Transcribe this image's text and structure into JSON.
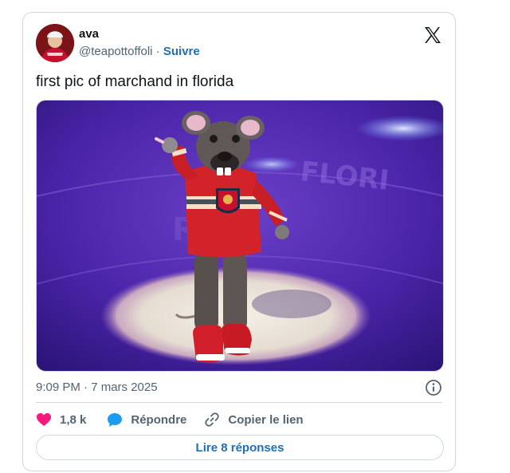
{
  "author": {
    "name": "ava",
    "handle": "@teapottoffoli",
    "separator": " · ",
    "follow_label": "Suivre"
  },
  "tweet": {
    "text": "first pic of marchand in florida",
    "timestamp": "9:09 PM · 7 mars 2025",
    "media_icon": "panthers-mascot-photo"
  },
  "actions": {
    "like_count": "1,8 k",
    "reply_label": "Répondre",
    "copy_label": "Copier le lien"
  },
  "footer": {
    "read_replies_label": "Lire 8 réponses"
  },
  "colors": {
    "accent": "#1d6fb8",
    "like": "#f91880",
    "reply": "#1d9bf0",
    "muted": "#536471",
    "border": "#cfd9de"
  }
}
